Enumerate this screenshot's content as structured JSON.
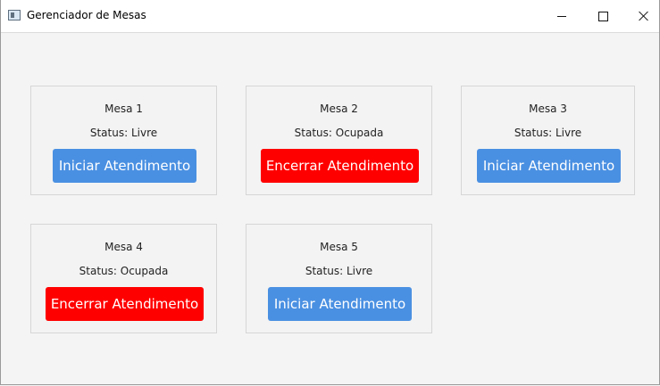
{
  "window": {
    "title": "Gerenciador de Mesas"
  },
  "tables": [
    {
      "name": "Mesa 1",
      "status": "Status: Livre",
      "button": "Iniciar Atendimento",
      "button_color": "#4a90e2"
    },
    {
      "name": "Mesa 2",
      "status": "Status: Ocupada",
      "button": "Encerrar Atendimento",
      "button_color": "#ff0000"
    },
    {
      "name": "Mesa 3",
      "status": "Status: Livre",
      "button": "Iniciar Atendimento",
      "button_color": "#4a90e2"
    },
    {
      "name": "Mesa 4",
      "status": "Status: Ocupada",
      "button": "Encerrar Atendimento",
      "button_color": "#ff0000"
    },
    {
      "name": "Mesa 5",
      "status": "Status: Livre",
      "button": "Iniciar Atendimento",
      "button_color": "#4a90e2"
    }
  ]
}
